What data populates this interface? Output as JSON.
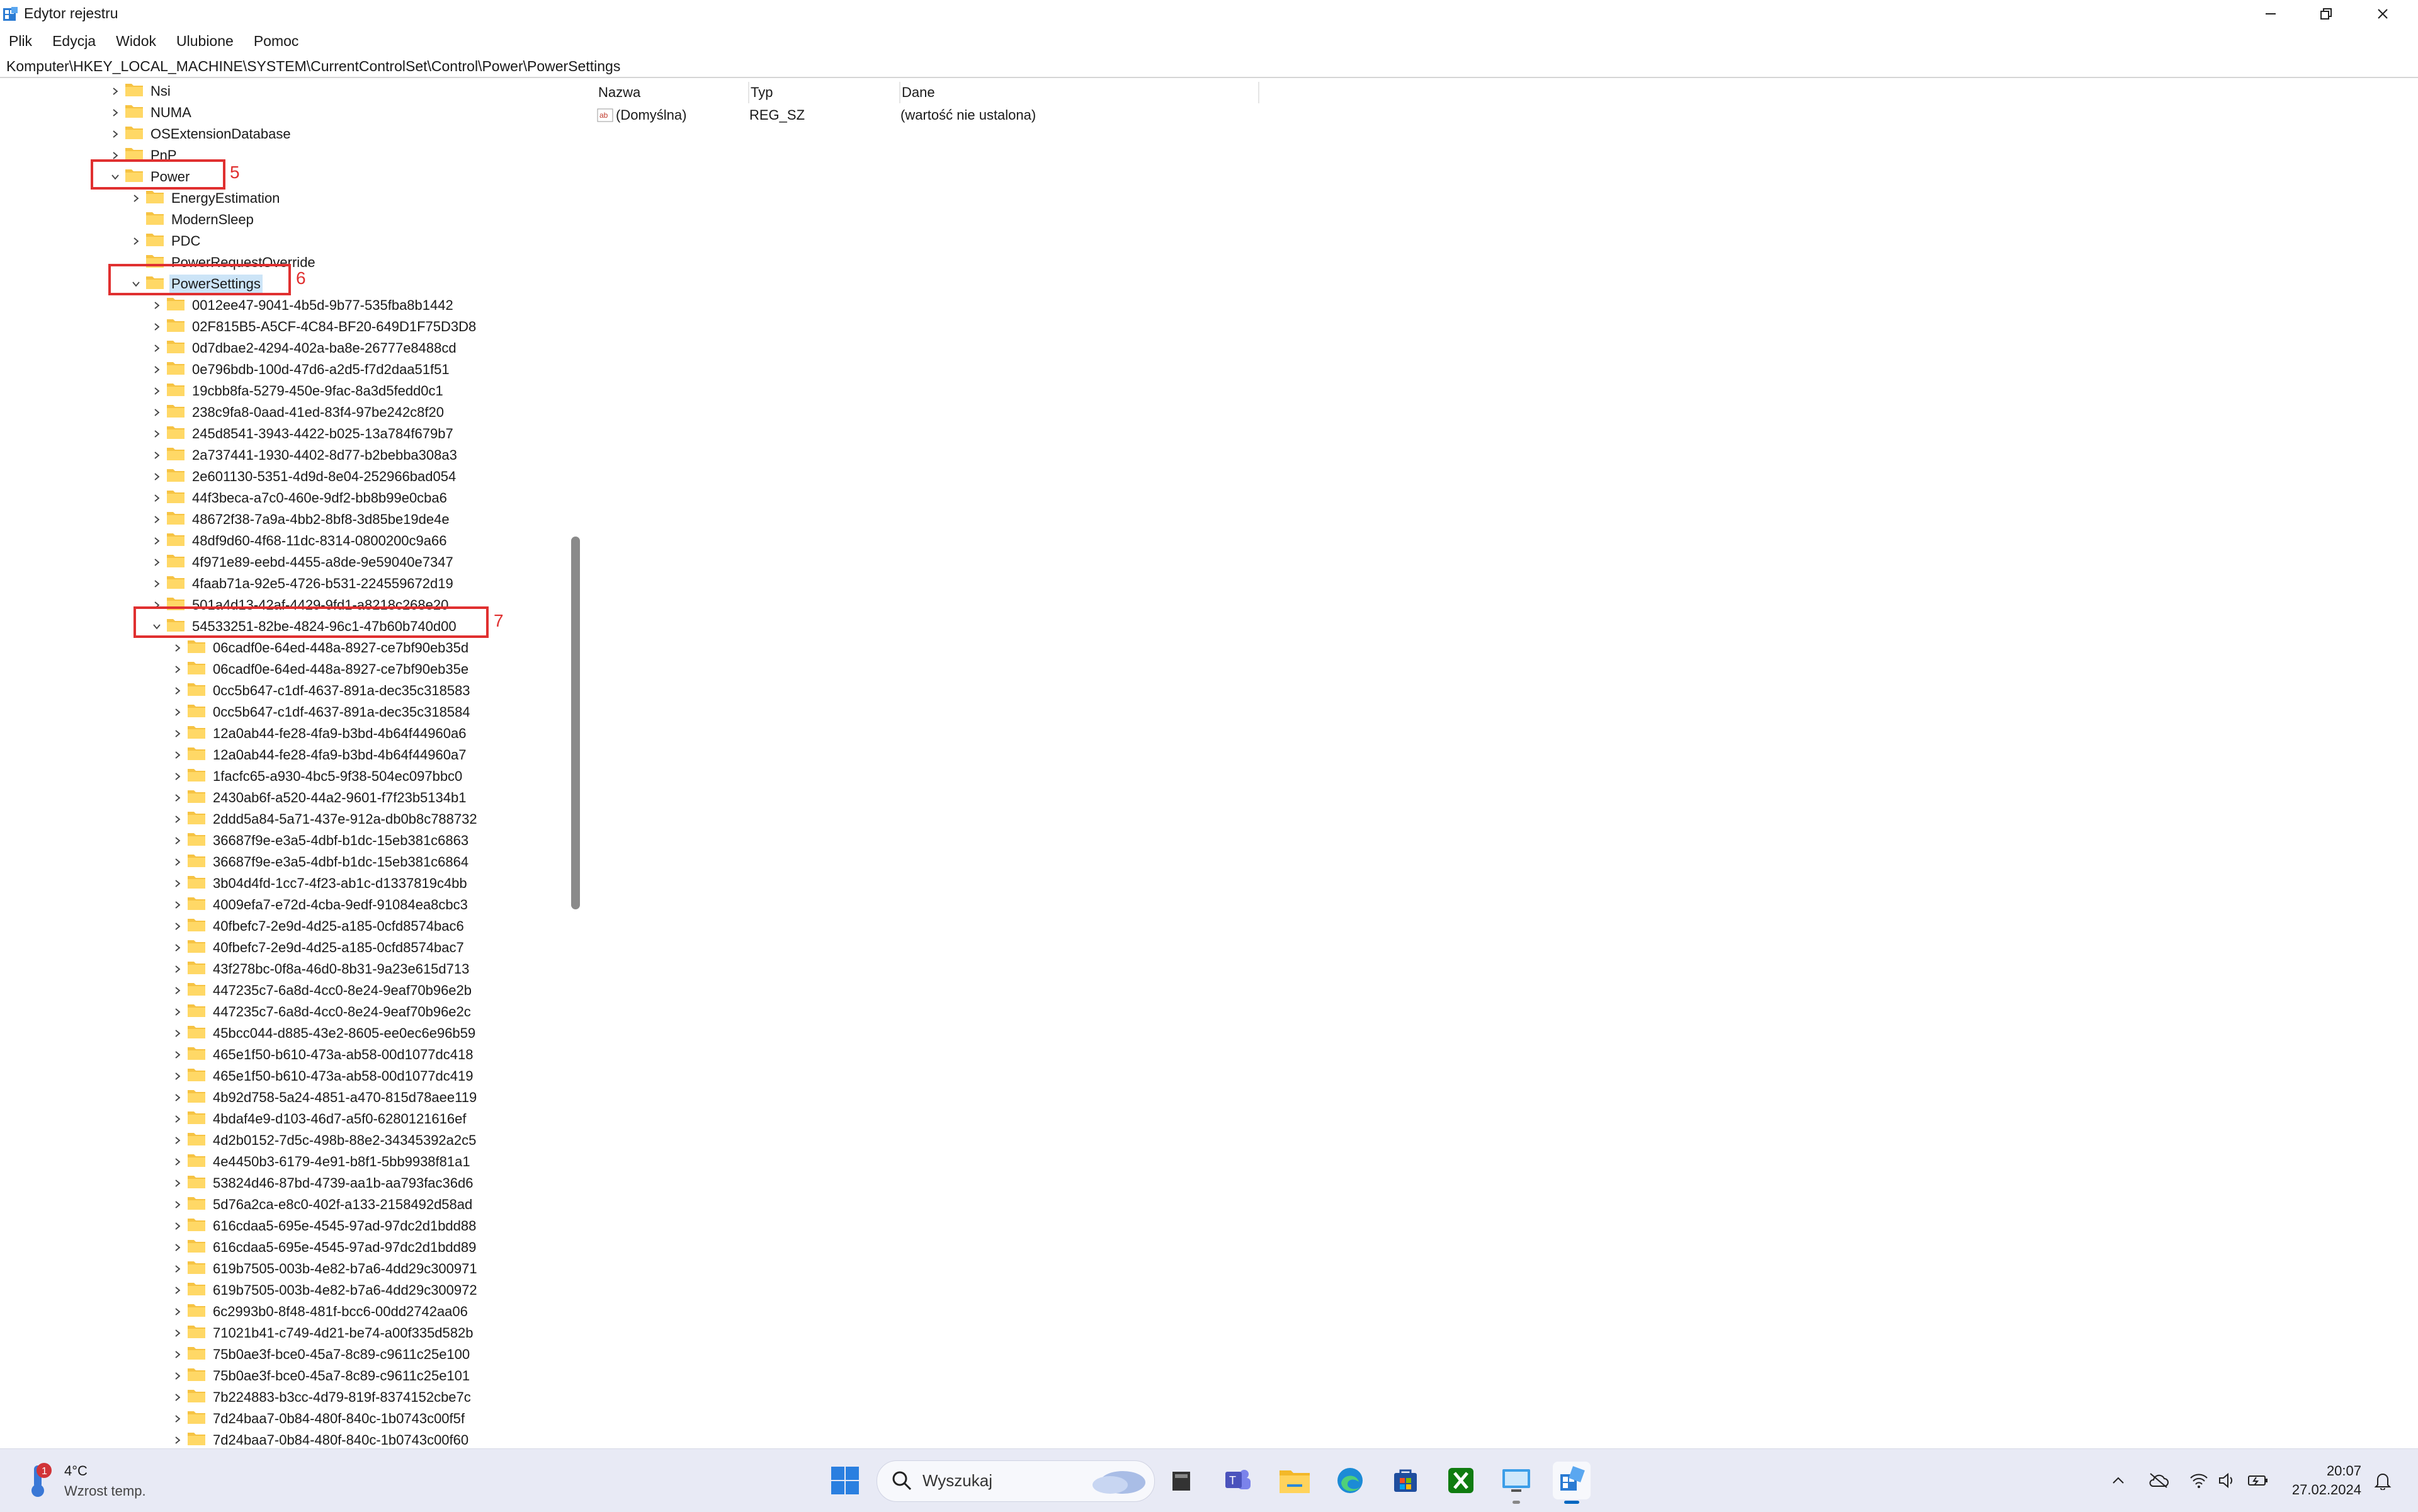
{
  "window": {
    "title": "Edytor rejestru"
  },
  "menu": [
    "Plik",
    "Edycja",
    "Widok",
    "Ulubione",
    "Pomoc"
  ],
  "address": "Komputer\\HKEY_LOCAL_MACHINE\\SYSTEM\\CurrentControlSet\\Control\\Power\\PowerSettings",
  "tree": [
    {
      "label": "Nsi",
      "level": 0,
      "chevron": "collapsed"
    },
    {
      "label": "NUMA",
      "level": 0,
      "chevron": "collapsed"
    },
    {
      "label": "OSExtensionDatabase",
      "level": 0,
      "chevron": "collapsed"
    },
    {
      "label": "PnP",
      "level": 0,
      "chevron": "collapsed"
    },
    {
      "label": "Power",
      "level": 0,
      "chevron": "expanded"
    },
    {
      "label": "EnergyEstimation",
      "level": 1,
      "chevron": "collapsed"
    },
    {
      "label": "ModernSleep",
      "level": 1,
      "chevron": "none"
    },
    {
      "label": "PDC",
      "level": 1,
      "chevron": "collapsed"
    },
    {
      "label": "PowerRequestOverride",
      "level": 1,
      "chevron": "none"
    },
    {
      "label": "PowerSettings",
      "level": 1,
      "chevron": "expanded",
      "selected": true
    },
    {
      "label": "0012ee47-9041-4b5d-9b77-535fba8b1442",
      "level": 2,
      "chevron": "collapsed"
    },
    {
      "label": "02F815B5-A5CF-4C84-BF20-649D1F75D3D8",
      "level": 2,
      "chevron": "collapsed"
    },
    {
      "label": "0d7dbae2-4294-402a-ba8e-26777e8488cd",
      "level": 2,
      "chevron": "collapsed"
    },
    {
      "label": "0e796bdb-100d-47d6-a2d5-f7d2daa51f51",
      "level": 2,
      "chevron": "collapsed"
    },
    {
      "label": "19cbb8fa-5279-450e-9fac-8a3d5fedd0c1",
      "level": 2,
      "chevron": "collapsed"
    },
    {
      "label": "238c9fa8-0aad-41ed-83f4-97be242c8f20",
      "level": 2,
      "chevron": "collapsed"
    },
    {
      "label": "245d8541-3943-4422-b025-13a784f679b7",
      "level": 2,
      "chevron": "collapsed"
    },
    {
      "label": "2a737441-1930-4402-8d77-b2bebba308a3",
      "level": 2,
      "chevron": "collapsed"
    },
    {
      "label": "2e601130-5351-4d9d-8e04-252966bad054",
      "level": 2,
      "chevron": "collapsed"
    },
    {
      "label": "44f3beca-a7c0-460e-9df2-bb8b99e0cba6",
      "level": 2,
      "chevron": "collapsed"
    },
    {
      "label": "48672f38-7a9a-4bb2-8bf8-3d85be19de4e",
      "level": 2,
      "chevron": "collapsed"
    },
    {
      "label": "48df9d60-4f68-11dc-8314-0800200c9a66",
      "level": 2,
      "chevron": "collapsed"
    },
    {
      "label": "4f971e89-eebd-4455-a8de-9e59040e7347",
      "level": 2,
      "chevron": "collapsed"
    },
    {
      "label": "4faab71a-92e5-4726-b531-224559672d19",
      "level": 2,
      "chevron": "collapsed"
    },
    {
      "label": "501a4d13-42af-4429-9fd1-a8218c268e20",
      "level": 2,
      "chevron": "collapsed"
    },
    {
      "label": "54533251-82be-4824-96c1-47b60b740d00",
      "level": 2,
      "chevron": "expanded"
    },
    {
      "label": "06cadf0e-64ed-448a-8927-ce7bf90eb35d",
      "level": 3,
      "chevron": "collapsed"
    },
    {
      "label": "06cadf0e-64ed-448a-8927-ce7bf90eb35e",
      "level": 3,
      "chevron": "collapsed"
    },
    {
      "label": "0cc5b647-c1df-4637-891a-dec35c318583",
      "level": 3,
      "chevron": "collapsed"
    },
    {
      "label": "0cc5b647-c1df-4637-891a-dec35c318584",
      "level": 3,
      "chevron": "collapsed"
    },
    {
      "label": "12a0ab44-fe28-4fa9-b3bd-4b64f44960a6",
      "level": 3,
      "chevron": "collapsed"
    },
    {
      "label": "12a0ab44-fe28-4fa9-b3bd-4b64f44960a7",
      "level": 3,
      "chevron": "collapsed"
    },
    {
      "label": "1facfc65-a930-4bc5-9f38-504ec097bbc0",
      "level": 3,
      "chevron": "collapsed"
    },
    {
      "label": "2430ab6f-a520-44a2-9601-f7f23b5134b1",
      "level": 3,
      "chevron": "collapsed"
    },
    {
      "label": "2ddd5a84-5a71-437e-912a-db0b8c788732",
      "level": 3,
      "chevron": "collapsed"
    },
    {
      "label": "36687f9e-e3a5-4dbf-b1dc-15eb381c6863",
      "level": 3,
      "chevron": "collapsed"
    },
    {
      "label": "36687f9e-e3a5-4dbf-b1dc-15eb381c6864",
      "level": 3,
      "chevron": "collapsed"
    },
    {
      "label": "3b04d4fd-1cc7-4f23-ab1c-d1337819c4bb",
      "level": 3,
      "chevron": "collapsed"
    },
    {
      "label": "4009efa7-e72d-4cba-9edf-91084ea8cbc3",
      "level": 3,
      "chevron": "collapsed"
    },
    {
      "label": "40fbefc7-2e9d-4d25-a185-0cfd8574bac6",
      "level": 3,
      "chevron": "collapsed"
    },
    {
      "label": "40fbefc7-2e9d-4d25-a185-0cfd8574bac7",
      "level": 3,
      "chevron": "collapsed"
    },
    {
      "label": "43f278bc-0f8a-46d0-8b31-9a23e615d713",
      "level": 3,
      "chevron": "collapsed"
    },
    {
      "label": "447235c7-6a8d-4cc0-8e24-9eaf70b96e2b",
      "level": 3,
      "chevron": "collapsed"
    },
    {
      "label": "447235c7-6a8d-4cc0-8e24-9eaf70b96e2c",
      "level": 3,
      "chevron": "collapsed"
    },
    {
      "label": "45bcc044-d885-43e2-8605-ee0ec6e96b59",
      "level": 3,
      "chevron": "collapsed"
    },
    {
      "label": "465e1f50-b610-473a-ab58-00d1077dc418",
      "level": 3,
      "chevron": "collapsed"
    },
    {
      "label": "465e1f50-b610-473a-ab58-00d1077dc419",
      "level": 3,
      "chevron": "collapsed"
    },
    {
      "label": "4b92d758-5a24-4851-a470-815d78aee119",
      "level": 3,
      "chevron": "collapsed"
    },
    {
      "label": "4bdaf4e9-d103-46d7-a5f0-6280121616ef",
      "level": 3,
      "chevron": "collapsed"
    },
    {
      "label": "4d2b0152-7d5c-498b-88e2-34345392a2c5",
      "level": 3,
      "chevron": "collapsed"
    },
    {
      "label": "4e4450b3-6179-4e91-b8f1-5bb9938f81a1",
      "level": 3,
      "chevron": "collapsed"
    },
    {
      "label": "53824d46-87bd-4739-aa1b-aa793fac36d6",
      "level": 3,
      "chevron": "collapsed"
    },
    {
      "label": "5d76a2ca-e8c0-402f-a133-2158492d58ad",
      "level": 3,
      "chevron": "collapsed"
    },
    {
      "label": "616cdaa5-695e-4545-97ad-97dc2d1bdd88",
      "level": 3,
      "chevron": "collapsed"
    },
    {
      "label": "616cdaa5-695e-4545-97ad-97dc2d1bdd89",
      "level": 3,
      "chevron": "collapsed"
    },
    {
      "label": "619b7505-003b-4e82-b7a6-4dd29c300971",
      "level": 3,
      "chevron": "collapsed"
    },
    {
      "label": "619b7505-003b-4e82-b7a6-4dd29c300972",
      "level": 3,
      "chevron": "collapsed"
    },
    {
      "label": "6c2993b0-8f48-481f-bcc6-00dd2742aa06",
      "level": 3,
      "chevron": "collapsed"
    },
    {
      "label": "71021b41-c749-4d21-be74-a00f335d582b",
      "level": 3,
      "chevron": "collapsed"
    },
    {
      "label": "75b0ae3f-bce0-45a7-8c89-c9611c25e100",
      "level": 3,
      "chevron": "collapsed"
    },
    {
      "label": "75b0ae3f-bce0-45a7-8c89-c9611c25e101",
      "level": 3,
      "chevron": "collapsed"
    },
    {
      "label": "7b224883-b3cc-4d79-819f-8374152cbe7c",
      "level": 3,
      "chevron": "collapsed"
    },
    {
      "label": "7d24baa7-0b84-480f-840c-1b0743c00f5f",
      "level": 3,
      "chevron": "collapsed"
    },
    {
      "label": "7d24baa7-0b84-480f-840c-1b0743c00f60",
      "level": 3,
      "chevron": "collapsed"
    }
  ],
  "annotations": [
    "5",
    "6",
    "7"
  ],
  "list": {
    "columns": [
      "Nazwa",
      "Typ",
      "Dane"
    ],
    "rows": [
      {
        "icon": "ab",
        "name": "(Domyślna)",
        "type": "REG_SZ",
        "data": "(wartość nie ustalona)"
      }
    ]
  },
  "taskbar": {
    "weather_temp": "4°C",
    "weather_desc": "Wzrost temp.",
    "weather_badge": "1",
    "search_placeholder": "Wyszukaj",
    "time": "20:07",
    "date": "27.02.2024",
    "apps": [
      "start-icon",
      "file-icon",
      "teams-icon",
      "explorer-icon",
      "edge-icon",
      "store-icon",
      "xbox-icon",
      "remote-desktop-icon",
      "regedit-icon"
    ],
    "tray": [
      "chevron-up-icon",
      "cloud-off-icon",
      "wifi-icon",
      "volume-icon",
      "battery-icon",
      "bell-icon"
    ]
  },
  "colors": {
    "annotation": "#e03030",
    "folder": "#f6c343",
    "selection": "#cce4f7",
    "taskbar": "#e8eaf5"
  }
}
